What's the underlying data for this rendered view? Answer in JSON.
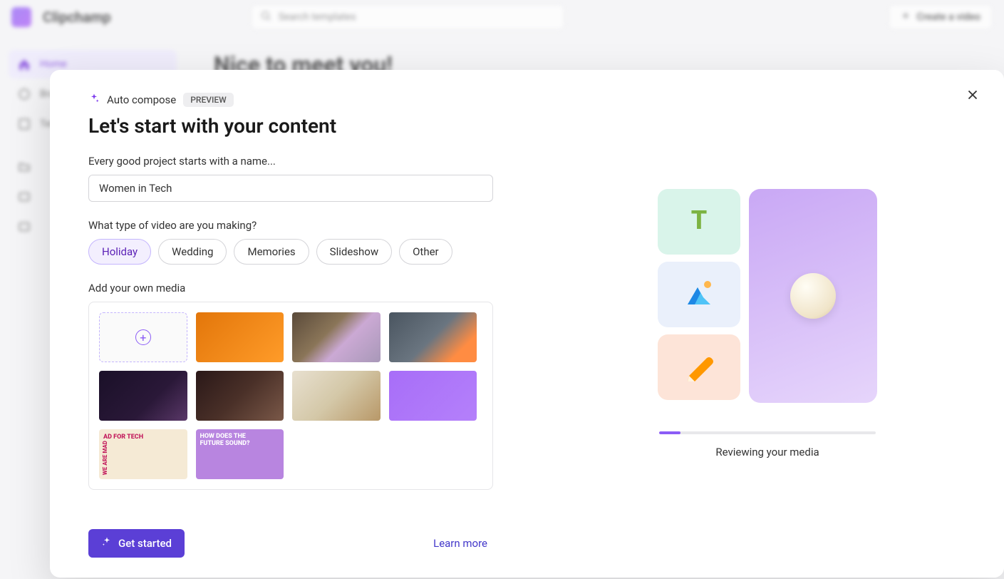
{
  "app": {
    "brand": "Clipchamp",
    "search_placeholder": "Search templates",
    "create_button": "Create a video"
  },
  "sidebar": {
    "items": [
      {
        "label": "Home",
        "icon": "home-icon",
        "active": true
      },
      {
        "label": "Brand kit",
        "icon": "palette-icon"
      },
      {
        "label": "Templates",
        "icon": "template-icon"
      }
    ],
    "section_label": "",
    "secondary": [
      {
        "label": "",
        "icon": "folder-icon"
      },
      {
        "label": "",
        "icon": "video-icon"
      },
      {
        "label": "",
        "icon": "video-icon"
      }
    ]
  },
  "main": {
    "title": "Nice to meet you!"
  },
  "modal": {
    "compose_label": "Auto compose",
    "preview_badge": "PREVIEW",
    "title": "Let's start with your content",
    "name_label": "Every good project starts with a name...",
    "name_value": "Women in Tech",
    "type_label": "What type of video are you making?",
    "chips": [
      "Holiday",
      "Wedding",
      "Memories",
      "Slideshow",
      "Other"
    ],
    "selected_chip": 0,
    "media_label": "Add your own media",
    "get_started": "Get started",
    "learn_more": "Learn more",
    "progress_label": "Reviewing your media",
    "progress_percent": 10
  }
}
